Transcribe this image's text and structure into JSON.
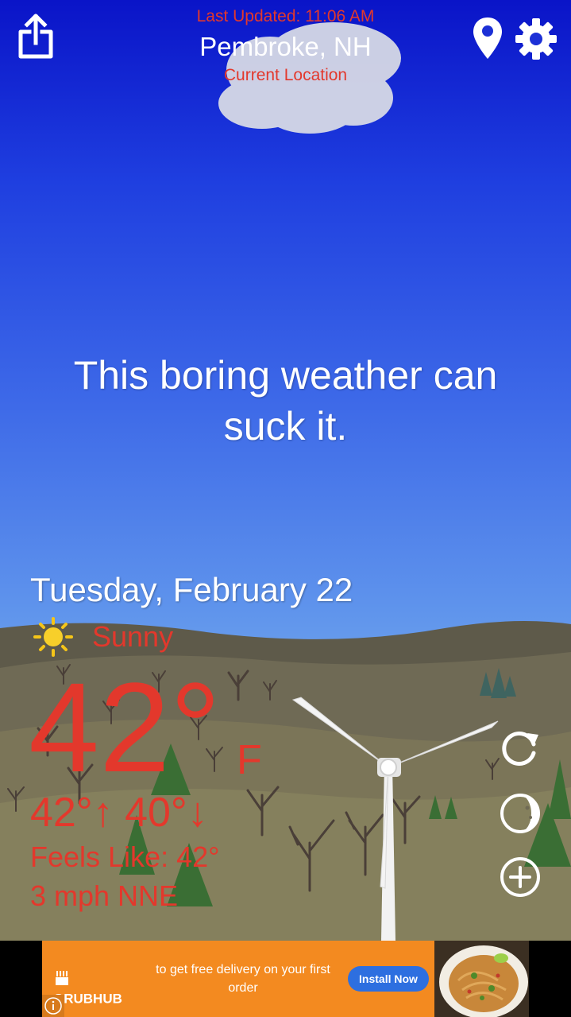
{
  "header": {
    "last_updated": "Last Updated: 11:06 AM",
    "city": "Pembroke, NH",
    "location_label": "Current Location"
  },
  "message": "This boring weather can suck it.",
  "weather": {
    "date": "Tuesday, February 22",
    "condition": "Sunny",
    "condition_icon": "sun-icon",
    "temperature": "42°",
    "unit": "F",
    "hi_lo": "42°↑ 40°↓",
    "feels_like": "Feels Like: 42°",
    "wind": "3 mph NNE"
  },
  "icons": {
    "share": "share-icon",
    "location": "location-pin-icon",
    "settings": "gear-icon",
    "refresh": "refresh-icon",
    "moon": "moon-phase-icon",
    "add": "add-icon"
  },
  "ad": {
    "brand": "GRUBHUB",
    "text": "to get free delivery on your first order",
    "cta": "Install Now"
  },
  "colors": {
    "accent_red": "#e3382c",
    "sky_top": "#0a14c8",
    "sky_bottom": "#9cc4ea",
    "ad_orange": "#f38a20",
    "ad_button": "#2d6fe0"
  }
}
